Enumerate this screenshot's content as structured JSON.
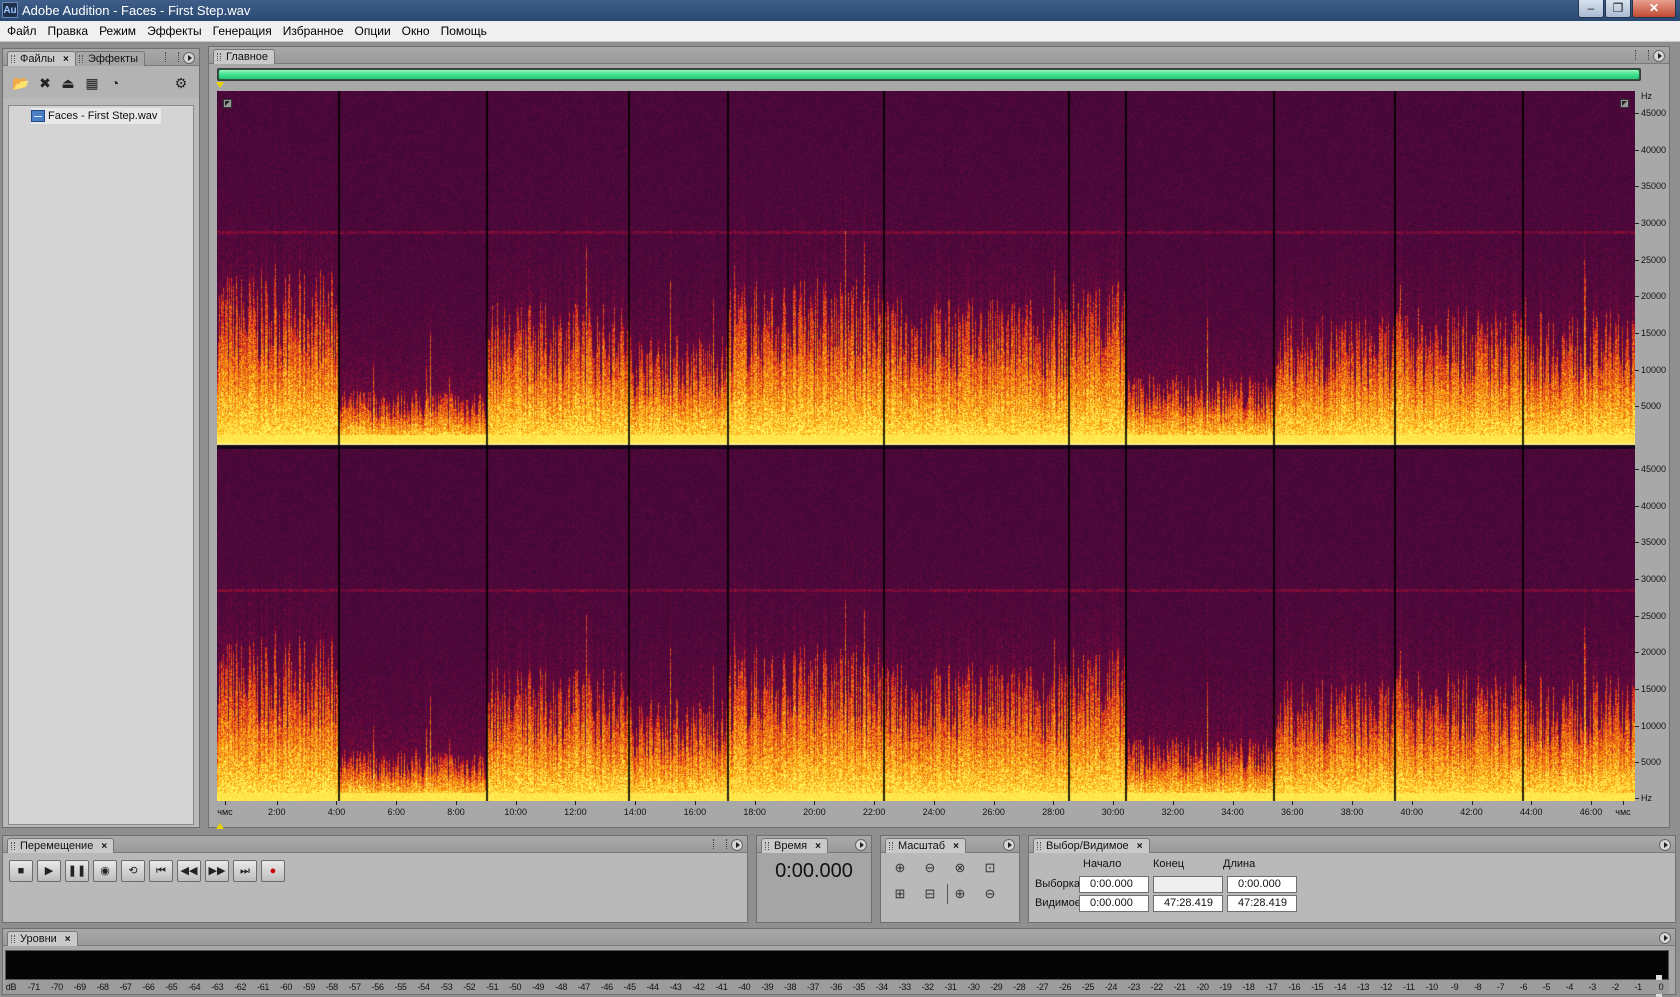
{
  "window": {
    "app_icon": "Au",
    "title": "Adobe Audition - Faces - First Step.wav",
    "min_glyph": "‒",
    "max_glyph": "❐",
    "close_glyph": "✕"
  },
  "menu": [
    "Файл",
    "Правка",
    "Режим",
    "Эффекты",
    "Генерация",
    "Избранное",
    "Опции",
    "Окно",
    "Помощь"
  ],
  "files_panel": {
    "tabs": [
      "Файлы",
      "Эффекты"
    ],
    "toolbar_icons": [
      "open-file-icon",
      "close-file-icon",
      "import-icon",
      "insert-multitrack-icon",
      "edit-file-icon",
      "auto-play-icon"
    ],
    "toolbar_glyphs": [
      "📂",
      "✖",
      "⏏",
      "▦",
      "◔",
      "⚙"
    ],
    "files": [
      {
        "name": "Faces - First Step.wav"
      }
    ]
  },
  "main_panel": {
    "tab": "Главное",
    "progress": 1.0,
    "freq_unit": "Hz",
    "freq_ticks_top": [
      "45000",
      "40000",
      "35000",
      "30000",
      "25000",
      "20000",
      "15000",
      "10000",
      "5000"
    ],
    "freq_ticks_bottom": [
      "45000",
      "40000",
      "35000",
      "30000",
      "25000",
      "20000",
      "15000",
      "10000",
      "5000",
      "Hz"
    ],
    "time_ticks": [
      "чмс",
      "2:00",
      "4:00",
      "6:00",
      "8:00",
      "10:00",
      "12:00",
      "14:00",
      "16:00",
      "18:00",
      "20:00",
      "22:00",
      "24:00",
      "26:00",
      "28:00",
      "30:00",
      "32:00",
      "34:00",
      "36:00",
      "38:00",
      "40:00",
      "42:00",
      "44:00",
      "46:00",
      "чмс"
    ],
    "colors": {
      "low": "#1a0822",
      "mid": "#c8142a",
      "high": "#ffe94a"
    }
  },
  "transport_panel": {
    "tab": "Перемещение",
    "buttons": [
      {
        "name": "stop-icon",
        "glyph": "■"
      },
      {
        "name": "play-icon",
        "glyph": "▶"
      },
      {
        "name": "pause-icon",
        "glyph": "❚❚"
      },
      {
        "name": "play-from-cursor-icon",
        "glyph": "◉"
      },
      {
        "name": "loop-play-icon",
        "glyph": "⟲"
      },
      {
        "name": "go-to-start-icon",
        "glyph": "⏮"
      },
      {
        "name": "rewind-icon",
        "glyph": "◀◀"
      },
      {
        "name": "fast-forward-icon",
        "glyph": "▶▶"
      },
      {
        "name": "go-to-end-icon",
        "glyph": "⏭"
      },
      {
        "name": "record-icon",
        "glyph": "●"
      }
    ]
  },
  "time_panel": {
    "tab": "Время",
    "value": "0:00.000"
  },
  "zoom_panel": {
    "tab": "Масштаб",
    "buttons": [
      {
        "name": "zoom-in-horizontal-icon",
        "glyph": "⊕"
      },
      {
        "name": "zoom-out-horizontal-icon",
        "glyph": "⊖"
      },
      {
        "name": "zoom-out-full-icon",
        "glyph": "⊗"
      },
      {
        "name": "zoom-to-selection-icon",
        "glyph": "⊡"
      },
      {
        "name": "zoom-left-edge-icon",
        "glyph": "⊞"
      },
      {
        "name": "zoom-right-edge-icon",
        "glyph": "⊟"
      },
      {
        "name": "zoom-in-vertical-icon",
        "glyph": "⊕"
      },
      {
        "name": "zoom-out-vertical-icon",
        "glyph": "⊖"
      }
    ]
  },
  "selection_panel": {
    "tab": "Выбор/Видимое",
    "headers": {
      "start": "Начало",
      "end": "Конец",
      "length": "Длина"
    },
    "rows": {
      "selection": {
        "label": "Выборка",
        "start": "0:00.000",
        "end": "",
        "length": "0:00.000"
      },
      "view": {
        "label": "Видимое",
        "start": "0:00.000",
        "end": "47:28.419",
        "length": "47:28.419"
      }
    }
  },
  "levels_panel": {
    "tab": "Уровни",
    "db_labels": [
      "dB",
      "-71",
      "-70",
      "-69",
      "-68",
      "-67",
      "-66",
      "-65",
      "-64",
      "-63",
      "-62",
      "-61",
      "-60",
      "-59",
      "-58",
      "-57",
      "-56",
      "-55",
      "-54",
      "-53",
      "-52",
      "-51",
      "-50",
      "-49",
      "-48",
      "-47",
      "-46",
      "-45",
      "-44",
      "-43",
      "-42",
      "-41",
      "-40",
      "-39",
      "-38",
      "-37",
      "-36",
      "-35",
      "-34",
      "-33",
      "-32",
      "-31",
      "-30",
      "-29",
      "-28",
      "-27",
      "-26",
      "-25",
      "-24",
      "-23",
      "-22",
      "-21",
      "-20",
      "-19",
      "-18",
      "-17",
      "-16",
      "-15",
      "-14",
      "-13",
      "-12",
      "-11",
      "-10",
      "-9",
      "-8",
      "-7",
      "-6",
      "-5",
      "-4",
      "-3",
      "-2",
      "-1",
      "0"
    ]
  }
}
